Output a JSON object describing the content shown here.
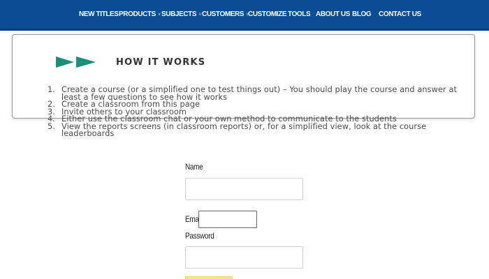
{
  "nav": {
    "items": [
      {
        "label": "NEW TITLES",
        "dropdown": false
      },
      {
        "label": "PRODUCTS",
        "dropdown": true
      },
      {
        "label": "SUBJECTS",
        "dropdown": true
      },
      {
        "label": "CUSTOMERS",
        "dropdown": true
      },
      {
        "label": "CUSTOMIZE",
        "dropdown": false
      },
      {
        "label": "TOOLS",
        "dropdown": false
      },
      {
        "label": "ABOUT US",
        "dropdown": false
      },
      {
        "label": "BLOG",
        "dropdown": false
      },
      {
        "label": "CONTACT US",
        "dropdown": false
      }
    ]
  },
  "how_it_works": {
    "title": "HOW IT WORKS",
    "steps": [
      {
        "num": "1.",
        "text": "Create a course (or a simplified one to test things out) – You should play the course and answer at least a few questions to see how it works"
      },
      {
        "num": "2.",
        "text": "Create a classroom from this page"
      },
      {
        "num": "3.",
        "text": "Invite others to your classroom"
      },
      {
        "num": "4.",
        "text": "Either use the classroom chat or your own method to communicate to the students"
      },
      {
        "num": "5.",
        "text": "View the reports screens (in classroom reports) or, for a simplified view, look at the course leaderboards"
      }
    ]
  },
  "form": {
    "name_label": "Name",
    "name_value": "",
    "email_label": "Email",
    "email_value": "",
    "password_label": "Password",
    "password_value": ""
  },
  "colors": {
    "nav_background": "#0b4d94",
    "arrow_accent": "#1a8f7a",
    "submit_button": "#f6e58d"
  }
}
